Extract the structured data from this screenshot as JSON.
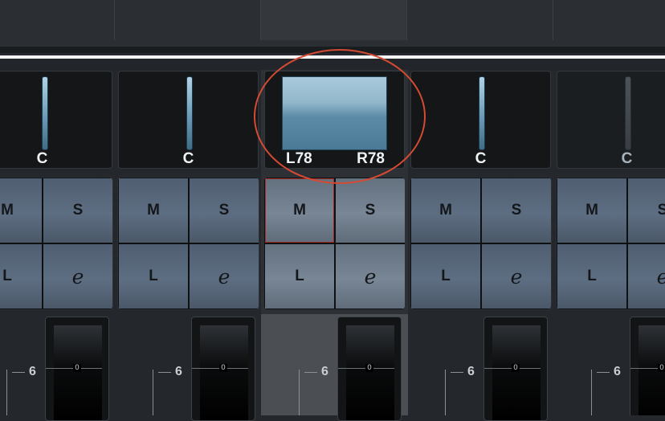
{
  "colors": {
    "background": "#24282c",
    "pan_bar": "#6a9bb6",
    "mute_highlight": "#a22b28",
    "annotation": "#d44a32"
  },
  "strips": [
    {
      "id": "ch1",
      "pan": "C",
      "mute": "M",
      "solo": "S",
      "listen": "L",
      "edit_icon": "e",
      "fader_scale": "6",
      "meter_zero": "0",
      "selected": false
    },
    {
      "id": "ch2",
      "pan": "C",
      "mute": "M",
      "solo": "S",
      "listen": "L",
      "edit_icon": "e",
      "fader_scale": "6",
      "meter_zero": "0",
      "selected": false
    },
    {
      "id": "ch3",
      "pan_left": "L78",
      "pan_right": "R78",
      "mute": "M",
      "solo": "S",
      "listen": "L",
      "edit_icon": "e",
      "fader_scale": "6",
      "meter_zero": "0",
      "selected": true
    },
    {
      "id": "ch4",
      "pan": "C",
      "mute": "M",
      "solo": "S",
      "listen": "L",
      "edit_icon": "e",
      "fader_scale": "6",
      "meter_zero": "0",
      "selected": false
    },
    {
      "id": "ch5",
      "pan": "C",
      "mute": "M",
      "solo": "S",
      "listen": "L",
      "edit_icon": "e",
      "fader_scale": "6",
      "meter_zero": "0",
      "selected": false
    }
  ]
}
